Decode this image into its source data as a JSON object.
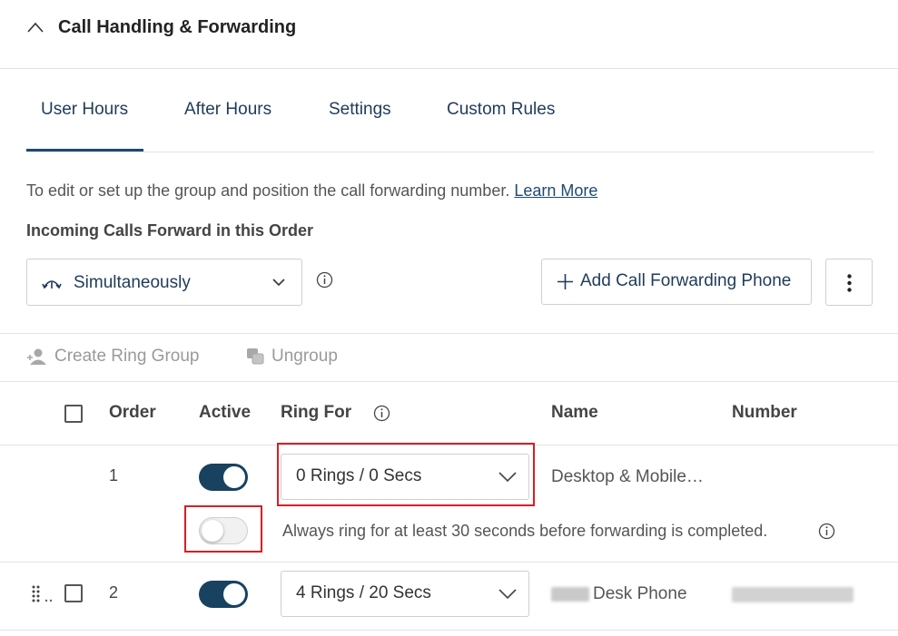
{
  "section": {
    "title": "Call Handling & Forwarding"
  },
  "tabs": [
    {
      "label": "User Hours",
      "active": true
    },
    {
      "label": "After Hours",
      "active": false
    },
    {
      "label": "Settings",
      "active": false
    },
    {
      "label": "Custom Rules",
      "active": false
    }
  ],
  "description": {
    "text": "To edit or set up the group and position the call forwarding number. ",
    "link": "Learn More"
  },
  "order": {
    "title": "Incoming Calls Forward in this Order",
    "mode_value": "Simultaneously",
    "add_button": "Add Call Forwarding Phone"
  },
  "toolbar": {
    "create_group": "Create Ring Group",
    "ungroup": "Ungroup"
  },
  "table": {
    "headers": {
      "order": "Order",
      "active": "Active",
      "ring_for": "Ring For",
      "name": "Name",
      "number": "Number"
    },
    "rows": [
      {
        "order": "1",
        "active": true,
        "ring_for": "0 Rings / 0 Secs",
        "name": "Desktop & Mobile…",
        "sub_toggle_on": false,
        "sub_text": "Always ring for at least 30 seconds before forwarding is completed."
      },
      {
        "order": "2",
        "active": true,
        "ring_for": "4 Rings / 20 Secs",
        "name": "Desk Phone"
      }
    ]
  },
  "colors": {
    "accent": "#18425f",
    "link": "#1d4a6e",
    "highlight": "#d61f26",
    "disabled": "#9a9a9a"
  },
  "icons": [
    "chevron-up-icon",
    "simultaneous-icon",
    "chevron-down-icon",
    "info-icon",
    "plus-icon",
    "kebab-menu-icon",
    "create-group-icon",
    "ungroup-icon",
    "drag-handle-icon"
  ]
}
